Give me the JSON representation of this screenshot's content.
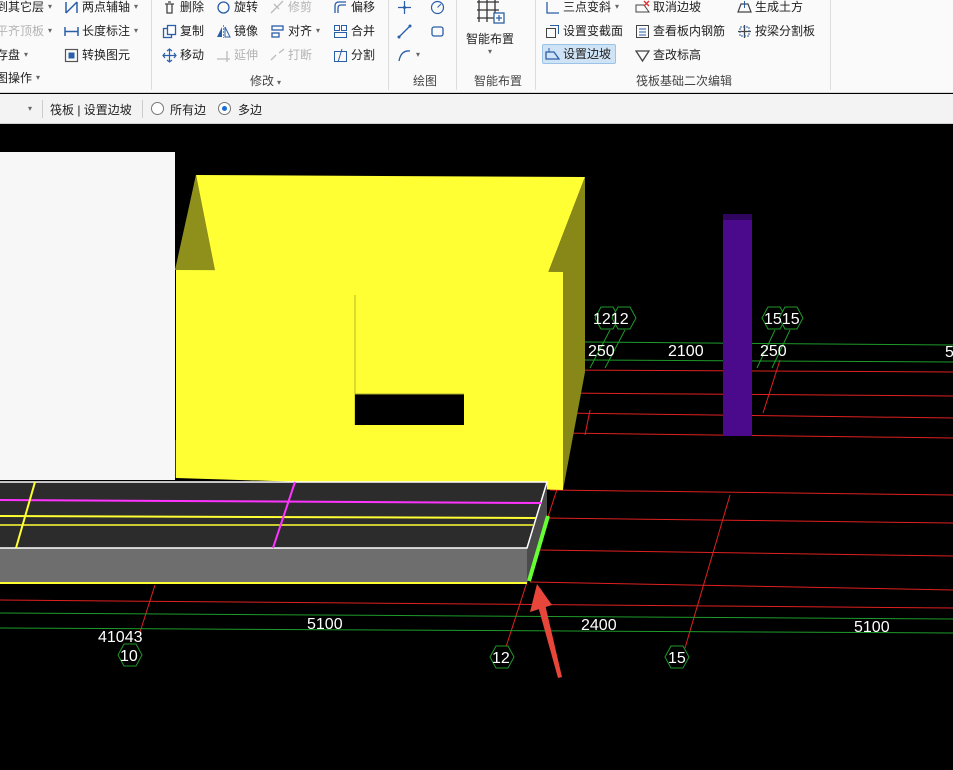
{
  "ribbon": {
    "group1": {
      "items": [
        {
          "label": "到其它层",
          "dropdown": true
        },
        {
          "label": "平齐顶板",
          "dropdown": true,
          "disabled": true
        },
        {
          "label": "存盘",
          "dropdown": true
        }
      ],
      "partial_label": "图操作",
      "col2": [
        {
          "label": "两点辅轴",
          "dropdown": true
        },
        {
          "label": "长度标注",
          "dropdown": true
        },
        {
          "label": "转换图元"
        }
      ]
    },
    "modify": {
      "col1": [
        {
          "label": "删除"
        },
        {
          "label": "复制"
        },
        {
          "label": "移动"
        }
      ],
      "col2": [
        {
          "label": "旋转"
        },
        {
          "label": "镜像"
        },
        {
          "label": "延伸",
          "disabled": true
        }
      ],
      "col3": [
        {
          "label": "修剪",
          "disabled": true
        },
        {
          "label": "对齐",
          "dropdown": true
        },
        {
          "label": "打断",
          "disabled": true
        }
      ],
      "col4": [
        {
          "label": "偏移"
        },
        {
          "label": "合并"
        },
        {
          "label": "分割"
        }
      ],
      "group_label": "修改"
    },
    "draw": {
      "group_label": "绘图"
    },
    "smart": {
      "button_label": "智能布置",
      "group_label": "智能布置"
    },
    "raft": {
      "col1": [
        {
          "label": "三点变斜",
          "dropdown": true
        },
        {
          "label": "设置变截面"
        },
        {
          "label": "设置边坡",
          "active": true
        }
      ],
      "col2": [
        {
          "label": "取消边坡"
        },
        {
          "label": "查看板内钢筋"
        },
        {
          "label": "查改标高"
        }
      ],
      "col3": [
        {
          "label": "生成土方"
        },
        {
          "label": "按梁分割板"
        }
      ],
      "group_label": "筏板基础二次编辑"
    }
  },
  "subbar": {
    "breadcrumb": "筏板 | 设置边坡",
    "options": [
      {
        "label": "所有边",
        "checked": false
      },
      {
        "label": "多边",
        "checked": true
      }
    ]
  },
  "viewport": {
    "axis_labels": {
      "a1": "1212",
      "a2": "1515",
      "a3": "10",
      "a4": "12",
      "a5": "15"
    },
    "dimensions": {
      "d1": "250",
      "d2": "2100",
      "d3": "250",
      "d4": "5",
      "d5": "41043",
      "d6": "5100",
      "d7": "2400",
      "d8": "5100"
    },
    "colors": {
      "background": "#000000",
      "yellow_block": "#ffff33",
      "purple_column": "#4b0a8c",
      "axis_red": "#e02020",
      "axis_green": "#1e9a2a",
      "highlight_edge": "#66ff33",
      "arrow": "#e8463a"
    }
  }
}
